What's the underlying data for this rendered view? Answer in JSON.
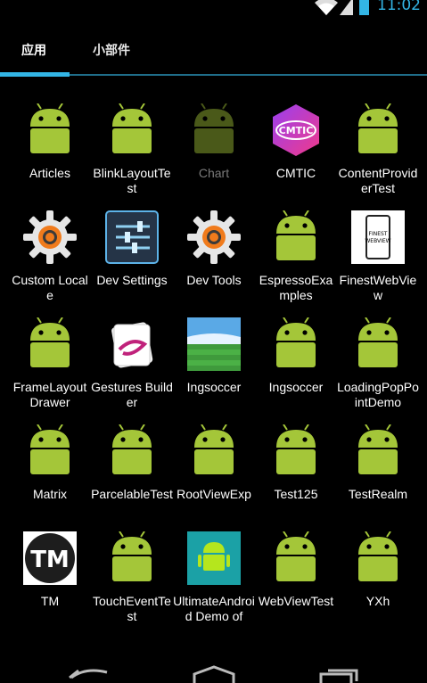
{
  "status": {
    "time": "11:02",
    "accent": "#33b5e5"
  },
  "tabs": [
    {
      "label": "应用",
      "active": true
    },
    {
      "label": "小部件",
      "active": false
    }
  ],
  "apps": [
    {
      "label": "Articles",
      "icon": "android-icon"
    },
    {
      "label": "BlinkLayoutTest",
      "icon": "android-icon"
    },
    {
      "label": "Chart",
      "icon": "android-icon",
      "dim": true
    },
    {
      "label": "CMTIC",
      "icon": "cmtic-logo-icon",
      "logo_text": "CMTIC"
    },
    {
      "label": "ContentProviderTest",
      "icon": "android-icon"
    },
    {
      "label": "Custom Locale",
      "icon": "settings-gear-icon"
    },
    {
      "label": "Dev Settings",
      "icon": "dev-settings-sliders-icon"
    },
    {
      "label": "Dev Tools",
      "icon": "settings-gear-icon"
    },
    {
      "label": "EspressoExamples",
      "icon": "android-icon"
    },
    {
      "label": "FinestWebView",
      "icon": "finest-webview-icon",
      "logo_text": "FINEST WEBVIEW"
    },
    {
      "label": "FrameLayoutDrawer",
      "icon": "android-icon"
    },
    {
      "label": "Gestures Builder",
      "icon": "gestures-builder-icon"
    },
    {
      "label": "Ingsoccer",
      "icon": "soccer-field-icon"
    },
    {
      "label": "Ingsoccer",
      "icon": "android-icon"
    },
    {
      "label": "LoadingPopPointDemo",
      "icon": "android-icon"
    },
    {
      "label": "Matrix",
      "icon": "android-icon"
    },
    {
      "label": "ParcelableTest",
      "icon": "android-icon"
    },
    {
      "label": "RootViewExp",
      "icon": "android-icon"
    },
    {
      "label": "Test125",
      "icon": "android-icon"
    },
    {
      "label": "TestRealm",
      "icon": "android-icon"
    },
    {
      "label": "TM",
      "icon": "tm-logo-icon",
      "logo_text": "TM"
    },
    {
      "label": "TouchEventTest",
      "icon": "android-icon"
    },
    {
      "label": "UltimateAndroid Demo of",
      "icon": "ultimate-android-icon"
    },
    {
      "label": "WebViewTest",
      "icon": "android-icon"
    },
    {
      "label": "YXh",
      "icon": "android-icon"
    }
  ]
}
